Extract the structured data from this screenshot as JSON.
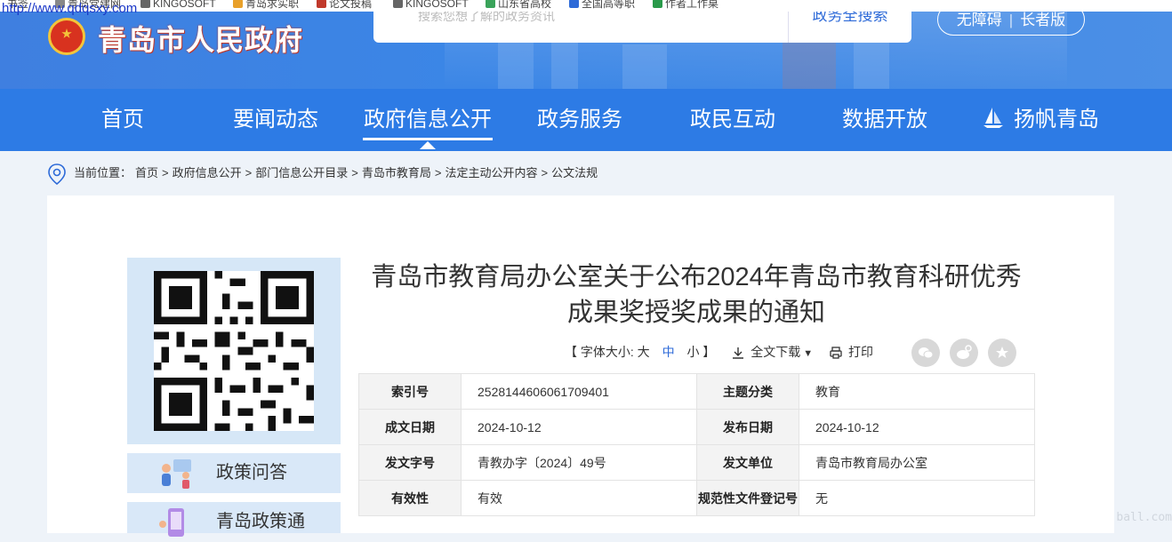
{
  "bookmarks": {
    "url_overlay": "http://www.qdqsxy.com",
    "items": [
      "书签",
      "青岛党建网",
      "KINGOSOFT",
      "青岛求实职",
      "论文投稿",
      "KINGOSOFT",
      "山东省高校",
      "全国高等职",
      "作者工作桌"
    ]
  },
  "header": {
    "site_title": "青岛市人民政府",
    "search_placeholder": "搜索您想了解的政务资讯",
    "search_button": "政务全搜索",
    "access_barrier_free": "无障碍",
    "access_elder": "长者版"
  },
  "nav": {
    "items": [
      "首页",
      "要闻动态",
      "政府信息公开",
      "政务服务",
      "政民互动",
      "数据开放",
      "扬帆青岛"
    ],
    "active_index": 2
  },
  "breadcrumb": {
    "label": "当前位置：",
    "items": [
      "首页",
      "政府信息公开",
      "部门信息公开目录",
      "青岛市教育局",
      "法定主动公开内容",
      "公文法规"
    ]
  },
  "sidebar": {
    "btn1": "政策问答",
    "btn2": "青岛政策通"
  },
  "document": {
    "title": "青岛市教育局办公室关于公布2024年青岛市教育科研优秀成果奖授奖成果的通知",
    "font_size_label": "【 字体大小: 大",
    "font_mid": "中",
    "font_small": "小 】",
    "download": "全文下载",
    "print": "打印"
  },
  "meta": {
    "rows": [
      {
        "k1": "索引号",
        "v1": "2528144606061709401",
        "k2": "主题分类",
        "v2": "教育"
      },
      {
        "k1": "成文日期",
        "v1": "2024-10-12",
        "k2": "发布日期",
        "v2": "2024-10-12"
      },
      {
        "k1": "发文字号",
        "v1": "青教办字〔2024〕49号",
        "k2": "发文单位",
        "v2": "青岛市教育局办公室"
      },
      {
        "k1": "有效性",
        "v1": "有效",
        "k2": "规范性文件登记号",
        "v2": "无"
      }
    ]
  },
  "watermark": "ball.com",
  "colors": {
    "nav_bg": "#2d7be5",
    "header_bg": "#3f7fe0",
    "accent": "#2d6ad8",
    "page_bg": "#eef3f9"
  }
}
